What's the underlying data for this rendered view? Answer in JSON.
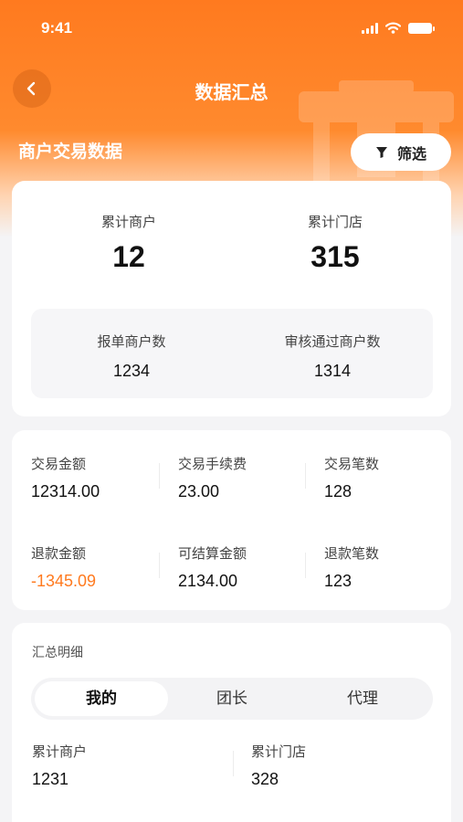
{
  "status_bar": {
    "time": "9:41"
  },
  "header": {
    "title": "数据汇总",
    "section_title": "商户交易数据",
    "filter_label": "筛选"
  },
  "summary": {
    "merchants_label": "累计商户",
    "merchants_value": "12",
    "stores_label": "累计门店",
    "stores_value": "315",
    "reported_label": "报单商户数",
    "reported_value": "1234",
    "approved_label": "审核通过商户数",
    "approved_value": "1314"
  },
  "transactions": {
    "rows": [
      [
        {
          "label": "交易金额",
          "value": "12314.00"
        },
        {
          "label": "交易手续费",
          "value": "23.00"
        },
        {
          "label": "交易笔数",
          "value": "128"
        }
      ],
      [
        {
          "label": "退款金额",
          "value": "-1345.09"
        },
        {
          "label": "可结算金额",
          "value": "2134.00"
        },
        {
          "label": "退款笔数",
          "value": "123"
        }
      ]
    ],
    "negative_color": "#ff7a1f"
  },
  "details": {
    "title": "汇总明细",
    "tabs": [
      "我的",
      "团长",
      "代理"
    ],
    "active_tab": "我的",
    "items": [
      {
        "label": "累计商户",
        "value": "1231"
      },
      {
        "label": "累计门店",
        "value": "328"
      }
    ]
  },
  "colors": {
    "brand": "#ff7a1f",
    "background": "#f4f4f6"
  },
  "icons": {
    "back": "chevron-left-icon",
    "filter": "funnel-icon"
  }
}
